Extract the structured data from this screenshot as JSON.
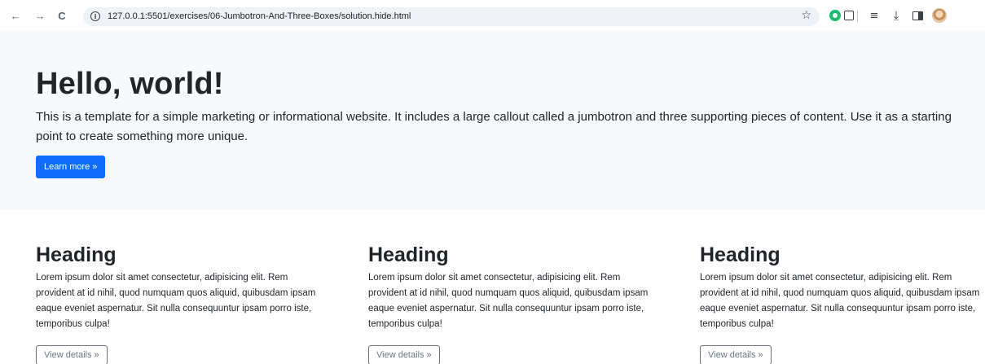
{
  "browser": {
    "url": "127.0.0.1:5501/exercises/06-Jumbotron-And-Three-Boxes/solution.hide.html",
    "icons": [
      "back-arrow-icon",
      "forward-arrow-icon",
      "reload-icon",
      "site-info-icon",
      "bookmark-star-icon",
      "green-extension-icon",
      "extensions-puzzle-icon",
      "reading-list-icon",
      "download-icon",
      "side-panel-icon",
      "profile-avatar"
    ],
    "back_glyph": "←",
    "forward_glyph": "→",
    "reload_glyph": "C",
    "info_glyph": "i",
    "star_glyph": "☆",
    "reading_list_glyph": "≡",
    "download_glyph": "⤓"
  },
  "jumbotron": {
    "title": "Hello, world!",
    "lead": "This is a template for a simple marketing or informational website. It includes a large callout called a jumbotron and three supporting pieces of content. Use it as a starting point to create something more unique.",
    "button_label": "Learn more »"
  },
  "columns": [
    {
      "heading": "Heading",
      "text": "Lorem ipsum dolor sit amet consectetur, adipisicing elit. Rem provident at id nihil, quod numquam quos aliquid, quibusdam ipsam eaque eveniet aspernatur. Sit nulla consequuntur ipsam porro iste, temporibus culpa!",
      "button_label": "View details »"
    },
    {
      "heading": "Heading",
      "text": "Lorem ipsum dolor sit amet consectetur, adipisicing elit. Rem provident at id nihil, quod numquam quos aliquid, quibusdam ipsam eaque eveniet aspernatur. Sit nulla consequuntur ipsam porro iste, temporibus culpa!",
      "button_label": "View details »"
    },
    {
      "heading": "Heading",
      "text": "Lorem ipsum dolor sit amet consectetur, adipisicing elit. Rem provident at id nihil, quod numquam quos aliquid, quibusdam ipsam eaque eveniet aspernatur. Sit nulla consequuntur ipsam porro iste, temporibus culpa!",
      "button_label": "View details »"
    }
  ],
  "colors": {
    "primary": "#0d6efd",
    "jumbotron_bg": "#f8f9fa",
    "text": "#212529",
    "secondary": "#6c757d"
  }
}
